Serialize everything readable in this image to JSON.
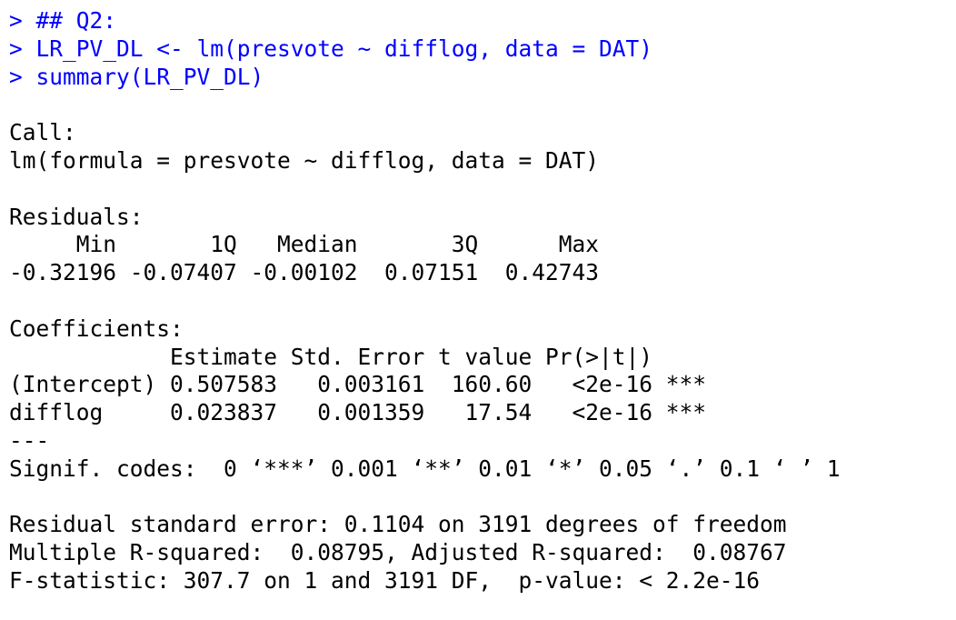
{
  "console": {
    "colors": {
      "command": "#0000ff",
      "output": "#000000",
      "background": "#ffffff"
    },
    "lines": [
      {
        "kind": "cmd",
        "text": "> ## Q2:"
      },
      {
        "kind": "cmd",
        "text": "> LR_PV_DL <- lm(presvote ~ difflog, data = DAT)"
      },
      {
        "kind": "cmd",
        "text": "> summary(LR_PV_DL)"
      },
      {
        "kind": "out",
        "text": ""
      },
      {
        "kind": "out",
        "text": "Call:"
      },
      {
        "kind": "out",
        "text": "lm(formula = presvote ~ difflog, data = DAT)"
      },
      {
        "kind": "out",
        "text": ""
      },
      {
        "kind": "out",
        "text": "Residuals:"
      },
      {
        "kind": "out",
        "text": "     Min       1Q   Median       3Q      Max "
      },
      {
        "kind": "out",
        "text": "-0.32196 -0.07407 -0.00102  0.07151  0.42743 "
      },
      {
        "kind": "out",
        "text": ""
      },
      {
        "kind": "out",
        "text": "Coefficients:"
      },
      {
        "kind": "out",
        "text": "            Estimate Std. Error t value Pr(>|t|)    "
      },
      {
        "kind": "out",
        "text": "(Intercept) 0.507583   0.003161  160.60   <2e-16 ***"
      },
      {
        "kind": "out",
        "text": "difflog     0.023837   0.001359   17.54   <2e-16 ***"
      },
      {
        "kind": "out",
        "text": "---"
      },
      {
        "kind": "out",
        "text": "Signif. codes:  0 ‘***’ 0.001 ‘**’ 0.01 ‘*’ 0.05 ‘.’ 0.1 ‘ ’ 1"
      },
      {
        "kind": "out",
        "text": ""
      },
      {
        "kind": "out",
        "text": "Residual standard error: 0.1104 on 3191 degrees of freedom"
      },
      {
        "kind": "out",
        "text": "Multiple R-squared:  0.08795,\tAdjusted R-squared:  0.08767 "
      },
      {
        "kind": "out",
        "text": "F-statistic: 307.7 on 1 and 3191 DF,  p-value: < 2.2e-16"
      }
    ]
  }
}
